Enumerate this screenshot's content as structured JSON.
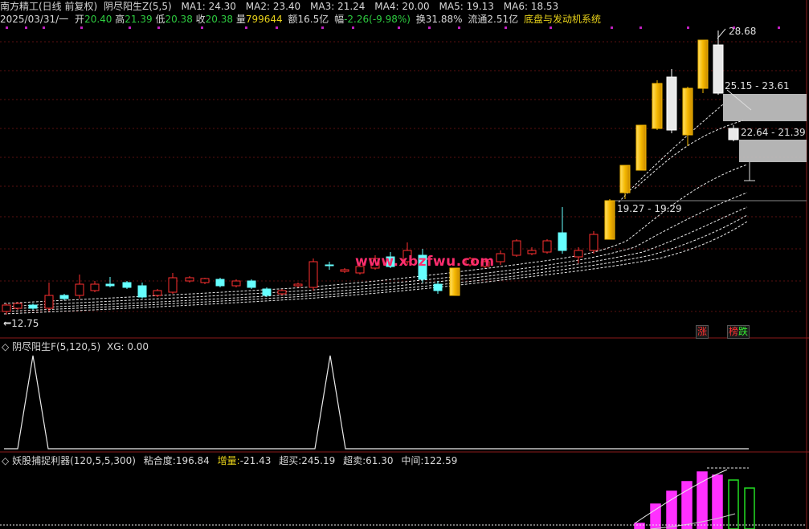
{
  "header": {
    "app_title": "南方精工(日线 前复权)",
    "formula_name": "阴尽阳生Z(5,5)",
    "ma": [
      "MA1: 24.30",
      "MA2: 23.40",
      "MA3: 21.24",
      "MA4: 20.00",
      "MA5: 19.13",
      "MA6: 18.53"
    ],
    "date": "2025/03/31/一",
    "open_label": "开",
    "open_value": "20.40",
    "high_label": "高",
    "high_value": "21.39",
    "low_label": "低",
    "low_value": "20.38",
    "close_label": "收",
    "close_value": "20.38",
    "vol_label": "量",
    "vol_value": "799644",
    "amount": "额16.5亿",
    "change_label": "幅",
    "change_value": "-2.26(-9.98%)",
    "turnover": "换31.88%",
    "float": "流通2.51亿",
    "system_name": "底盘与发动机系统"
  },
  "price_labels": {
    "high": "28.68",
    "zone1": "25.15 - 23.61",
    "zone2": "22.64 - 21.39",
    "support": "19.27 - 19.29",
    "low": "12.75"
  },
  "watermark": "www.xbzfwu.com",
  "signals": {
    "up": "涨",
    "stop": "榜",
    "down": "跌"
  },
  "panel2": {
    "title": "阴尽阳生F(5,120,5)",
    "xg": "XG: 0.00"
  },
  "panel3": {
    "title": "妖股捕捉利器(120,5,5,300)",
    "stick_label": "粘合度:",
    "stick_value": "196.84",
    "inc_label": "增量:",
    "inc_value": "-21.43",
    "ob_label": "超买:",
    "ob_value": "245.19",
    "os_label": "超卖:",
    "os_value": "61.30",
    "mid_label": "中间:",
    "mid_value": "122.59"
  },
  "colors": {
    "bg": "#000000",
    "up_candle": "#ff3030",
    "down_candle": "#66ffff",
    "limit_up": "#f5b800",
    "limit_down": "#ffffff",
    "magenta": "#ff30ff",
    "green": "#22dd22"
  }
}
